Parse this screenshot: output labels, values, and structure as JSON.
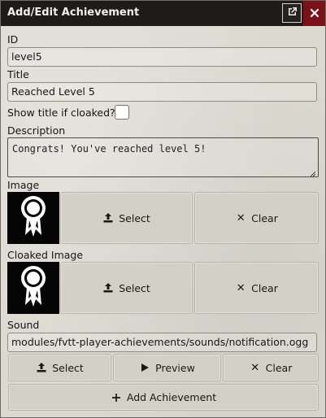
{
  "window": {
    "title": "Add/Edit Achievement",
    "popout_icon": "external-link-icon",
    "close_icon": "close-icon"
  },
  "form": {
    "id_label": "ID",
    "id_value": "level5",
    "title_label": "Title",
    "title_value": "Reached Level 5",
    "show_title_label": "Show title if cloaked?",
    "show_title_checked": false,
    "description_label": "Description",
    "description_value": "Congrats! You've reached level 5!",
    "image_label": "Image",
    "image_icon": "award-ribbon-icon",
    "image_select_label": "Select",
    "image_clear_label": "Clear",
    "cloaked_image_label": "Cloaked Image",
    "cloaked_image_icon": "award-ribbon-icon",
    "cloaked_select_label": "Select",
    "cloaked_clear_label": "Clear",
    "sound_label": "Sound",
    "sound_value": "modules/fvtt-player-achievements/sounds/notification.ogg",
    "sound_select_label": "Select",
    "sound_preview_label": "Preview",
    "sound_clear_label": "Clear",
    "submit_label": "Add Achievement"
  },
  "colors": {
    "titlebar": "#1d1c1a",
    "close_button": "#7a1217",
    "panel": "#dcd9d1",
    "thumbnail": "#050505"
  }
}
